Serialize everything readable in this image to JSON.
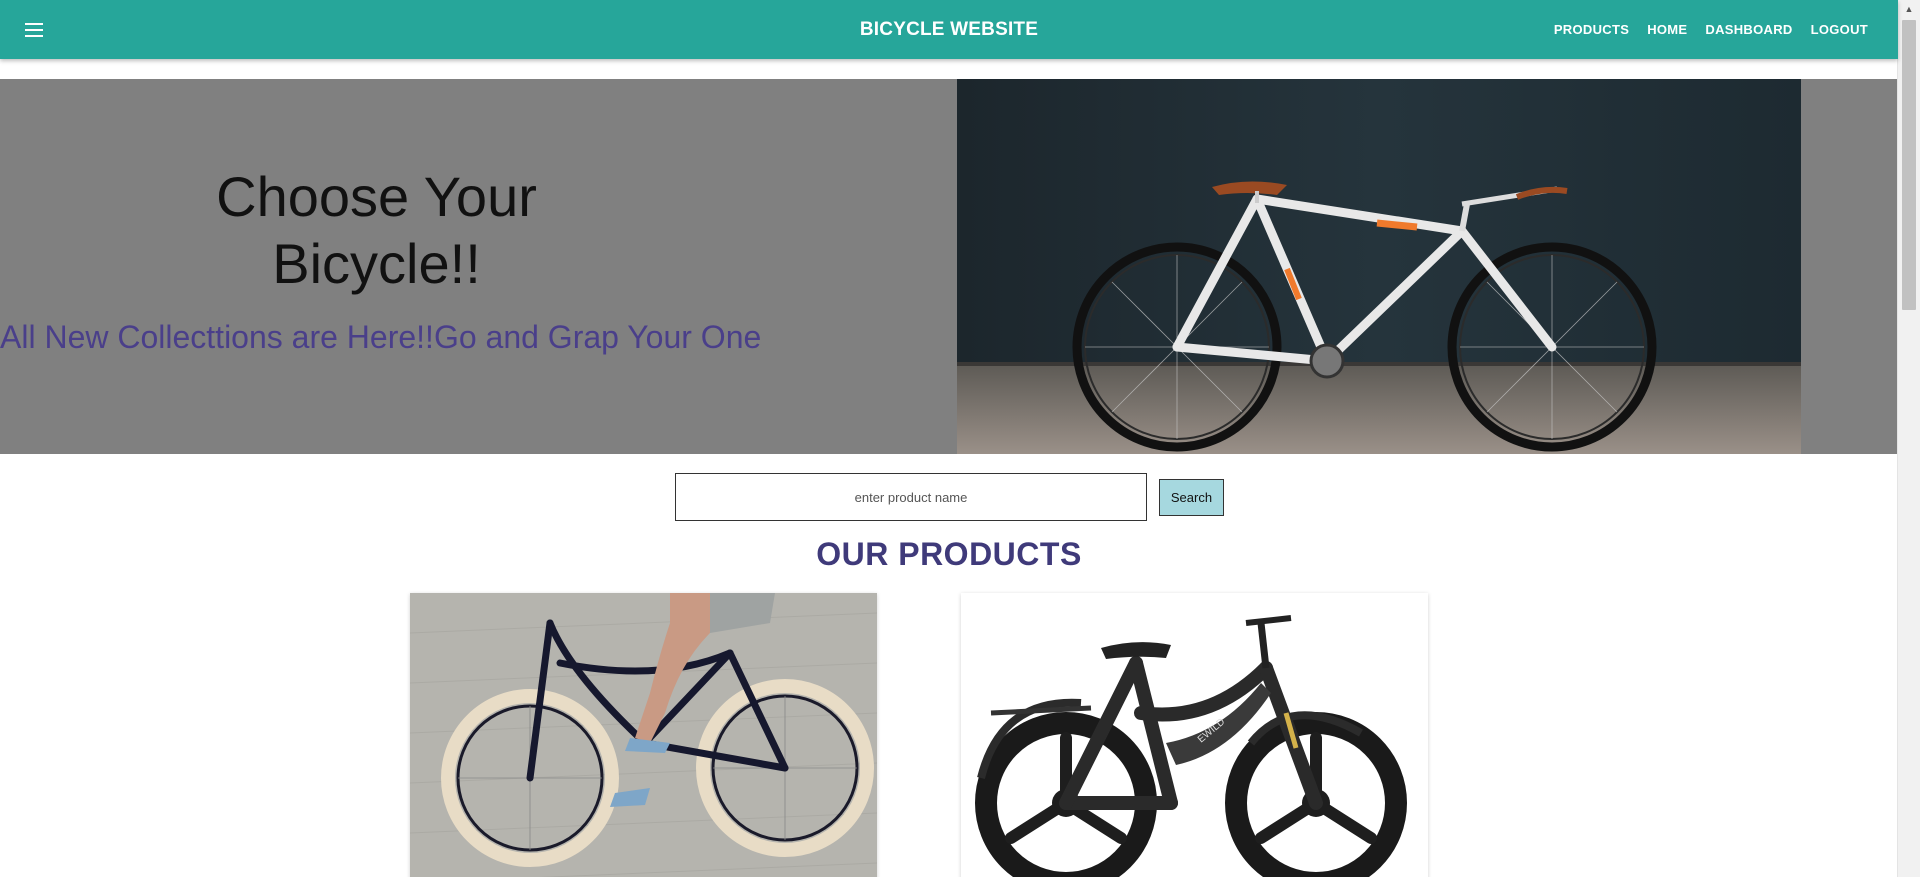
{
  "appbar": {
    "title": "BICYCLE WEBSITE",
    "menu_icon": "hamburger-menu-icon",
    "nav": [
      {
        "label": "PRODUCTS"
      },
      {
        "label": "HOME"
      },
      {
        "label": "DASHBOARD"
      },
      {
        "label": "LOGOUT"
      }
    ],
    "accent_color": "#26a69a"
  },
  "hero": {
    "title_line1": "Choose Your",
    "title_line2": "Bicycle!!",
    "subtitle": "All New Collecttions are Here!!Go and Grap Your One",
    "background_color": "#808080",
    "subtitle_color": "#4a3f8a"
  },
  "search": {
    "placeholder": "enter product name",
    "button_label": "Search",
    "button_color": "#a6d8df"
  },
  "products": {
    "heading": "OUR PRODUCTS",
    "heading_color": "#3f3a7a",
    "items": [
      {
        "image": "cruiser-bicycle-photo"
      },
      {
        "image": "electric-fat-tire-bike-photo"
      }
    ]
  }
}
